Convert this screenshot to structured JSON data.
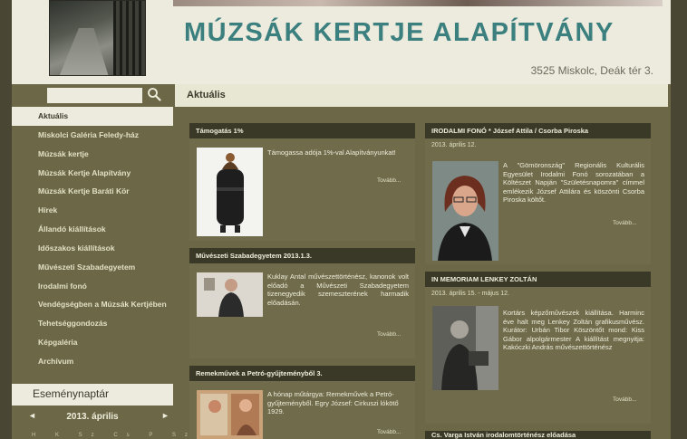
{
  "header": {
    "title": "MÚZSÁK KERTJE ALAPÍTVÁNY",
    "address": "3525 Miskolc, Deák tér 3."
  },
  "search": {
    "placeholder": "",
    "icon": "search-icon"
  },
  "nav": {
    "items": [
      {
        "label": "Aktuális",
        "active": true
      },
      {
        "label": "Miskolci Galéria Feledy-ház"
      },
      {
        "label": "Múzsák kertje"
      },
      {
        "label": "Múzsák Kertje Alapítvány"
      },
      {
        "label": "Múzsák Kertje Baráti Kör"
      },
      {
        "label": "Hírek"
      },
      {
        "label": "Állandó kiállítások"
      },
      {
        "label": "Időszakos kiállítások"
      },
      {
        "label": "Művészeti Szabadegyetem"
      },
      {
        "label": "Irodalmi fonó"
      },
      {
        "label": "Vendégségben a Múzsák Kertjében"
      },
      {
        "label": "Tehetséggondozás"
      },
      {
        "label": "Képgaléria"
      },
      {
        "label": "Archívum"
      }
    ]
  },
  "calendar": {
    "title": "Eseménynaptár",
    "month": "2013. április",
    "prev": "◄",
    "next": "►",
    "days": "H K Sz Cs P Sz V"
  },
  "main": {
    "section_title": "Aktuális",
    "cards": {
      "c1": {
        "title": "Támogatás 1%",
        "text": "Támogassa adója 1%-val Alapítványunkat!",
        "more": "Tovább..."
      },
      "c2": {
        "title": "Művészeti Szabadegyetem 2013.1.3.",
        "text": "Kuklay Antal művészettörténész, kanonok volt előadó a Művészeti Szabadegyetem tizenegyedik szemeszterének harmadik előadásán.",
        "more": "Tovább..."
      },
      "c3": {
        "title": "Remekművek a Petró-gyűjteményből 3.",
        "text": "A hónap műtárgya: Remekművek a Petró-gyűjteményből. Egry József: Cirkuszi lókötő 1929.",
        "more": "Tovább..."
      },
      "c4": {
        "title": "IRODALMI FONÓ * József Attila / Csorba Piroska",
        "date": "2013. április 12.",
        "text": "A \"Gömöronszág\" Regionális Kulturális Egyesület Irodalmi Fonó sorozatában a Költészet Napján \"Születésnapomra\" címmel emlékezik József Attilára és köszönti Csorba Piroska költőt.",
        "more": "Tovább..."
      },
      "c5": {
        "title": "IN MEMORIAM LENKEY ZOLTÁN",
        "date": "2013. április 15. - május 12.",
        "text": "Kortárs képzőművészek kiállítása. Harminc éve halt meg Lenkey Zoltán grafikusművész. Kurátor: Urbán Tibor Köszöntőt mond: Kiss Gábor alpolgármester A kiállítást megnyitja: Kakóczki András művészettörténész",
        "more": "Tovább..."
      },
      "c6": {
        "title": "Cs. Varga István irodalomtörténész előadása"
      }
    }
  }
}
